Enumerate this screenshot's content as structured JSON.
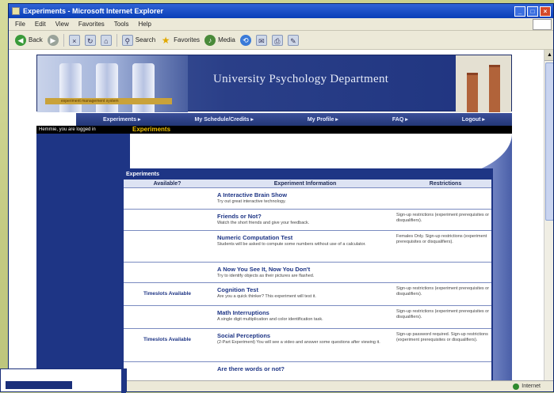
{
  "browser": {
    "title": "Experiments - Microsoft Internet Explorer",
    "menu": [
      "File",
      "Edit",
      "View",
      "Favorites",
      "Tools",
      "Help"
    ],
    "toolbar": {
      "back": "Back",
      "search": "Search",
      "favorites": "Favorites",
      "media": "Media"
    },
    "status": "Internet"
  },
  "banner": {
    "title": "University Psychology Department",
    "subtitle": "experiment management system"
  },
  "nav": [
    "Experiments ▸",
    "My Schedule/Credits ▸",
    "My Profile ▸",
    "FAQ ▸",
    "Logout ▸"
  ],
  "session": {
    "logged_in": "Hemmie, you are logged in"
  },
  "page": {
    "heading": "Experiments"
  },
  "table": {
    "title": "Experiments",
    "headers": [
      "Available?",
      "Experiment Information",
      "Restrictions"
    ],
    "rows": [
      {
        "available": "",
        "name": "A Interactive Brain Show",
        "desc": "Try out great interactive technology.",
        "restrictions": ""
      },
      {
        "available": "",
        "name": "Friends or Not?",
        "desc": "Watch the short friends and give your feedback.",
        "restrictions": "Sign-up restrictions (experiment prerequisites or disqualifiers)."
      },
      {
        "available": "",
        "name": "Numeric Computation Test",
        "desc": "Students will be asked to compute some numbers without use of a calculator.",
        "restrictions": "Females Only. Sign-up restrictions (experiment prerequisites or disqualifiers)."
      },
      {
        "available": "",
        "name": "A Now You See It, Now You Don't",
        "desc": "Try to identify objects as their pictures are flashed.",
        "restrictions": ""
      },
      {
        "available": "Timeslots Available",
        "name": "Cognition Test",
        "desc": "Are you a quick thinker? This experiment will test it.",
        "restrictions": "Sign-up restrictions (experiment prerequisites or disqualifiers)."
      },
      {
        "available": "",
        "name": "Math Interruptions",
        "desc": "A single digit multiplication and color identification task.",
        "restrictions": "Sign-up restrictions (experiment prerequisites or disqualifiers)."
      },
      {
        "available": "Timeslots Available",
        "name": "Social Perceptions",
        "desc": "(2-Part Experiment) You will see a video and answer some questions after viewing it.",
        "restrictions": "Sign-up password required. Sign-up restrictions (experiment prerequisites or disqualifiers)."
      },
      {
        "available": "",
        "name": "Are there words or not?",
        "desc": "",
        "restrictions": ""
      }
    ]
  }
}
